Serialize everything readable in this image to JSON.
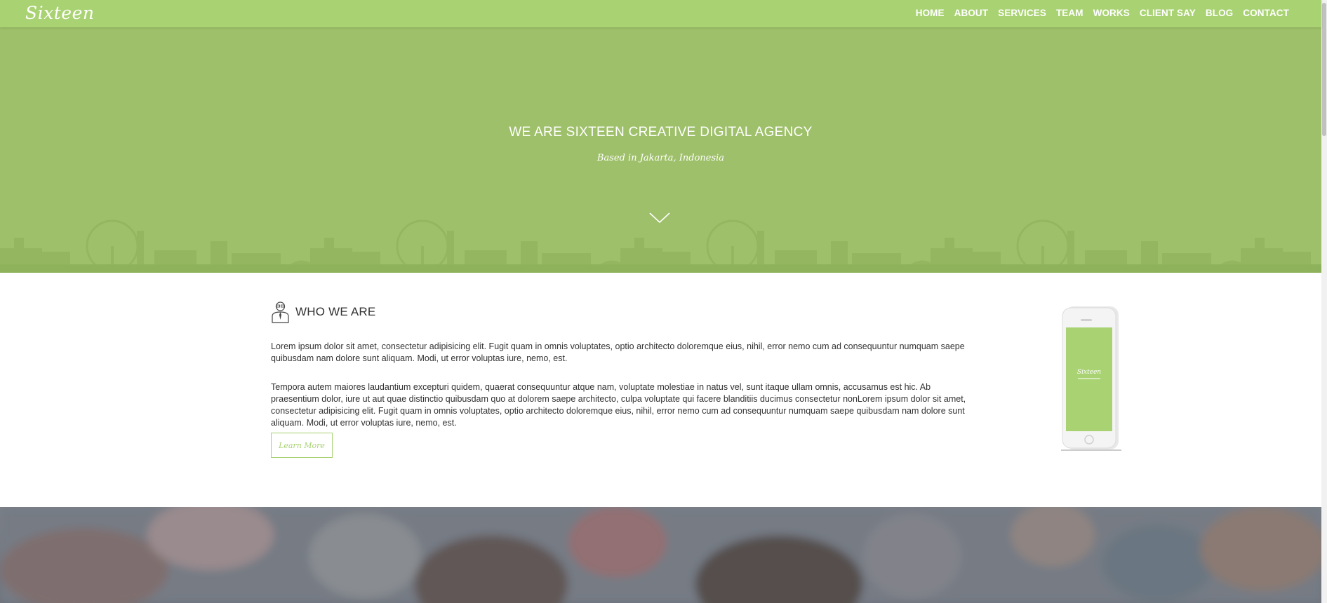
{
  "brand": {
    "logo": "Sixteen",
    "accent": "#a9d273"
  },
  "nav": {
    "items": [
      {
        "label": "HOME"
      },
      {
        "label": "ABOUT"
      },
      {
        "label": "SERVICES"
      },
      {
        "label": "TEAM"
      },
      {
        "label": "WORKS"
      },
      {
        "label": "CLIENT SAY"
      },
      {
        "label": "BLOG"
      },
      {
        "label": "CONTACT"
      }
    ]
  },
  "hero": {
    "title": "WE ARE SIXTEEN CREATIVE DIGITAL AGENCY",
    "subtitle": "Based in Jakarta, Indonesia",
    "background": "#9ec06a",
    "icons": {
      "scroll": "chevron-down-icon"
    }
  },
  "about": {
    "title": "WHO WE ARE",
    "icon": "person-icon",
    "paragraph1": "Lorem ipsum dolor sit amet, consectetur adipisicing elit. Fugit quam in omnis voluptates, optio architecto doloremque eius, nihil, error nemo cum ad consequuntur numquam saepe quibusdam nam dolore sunt aliquam. Modi, ut error voluptas iure, nemo, est.",
    "paragraph2": "Tempora autem maiores laudantium excepturi quidem, quaerat consequuntur atque nam, voluptate molestiae in natus vel, sunt itaque ullam omnis, accusamus est hic. Ab praesentium dolor, iure ut aut quae distinctio quibusdam quo at dolorem saepe architecto, culpa voluptate qui facere blanditiis ducimus consectetur nonLorem ipsum dolor sit amet, consectetur adipisicing elit. Fugit quam in omnis voluptates, optio architecto doloremque eius, nihil, error nemo cum ad consequuntur numquam saepe quibusdam nam dolore sunt aliquam. Modi, ut error voluptas iure, nemo, est.",
    "button": "Learn More",
    "phone_logo": "Sixteen"
  }
}
